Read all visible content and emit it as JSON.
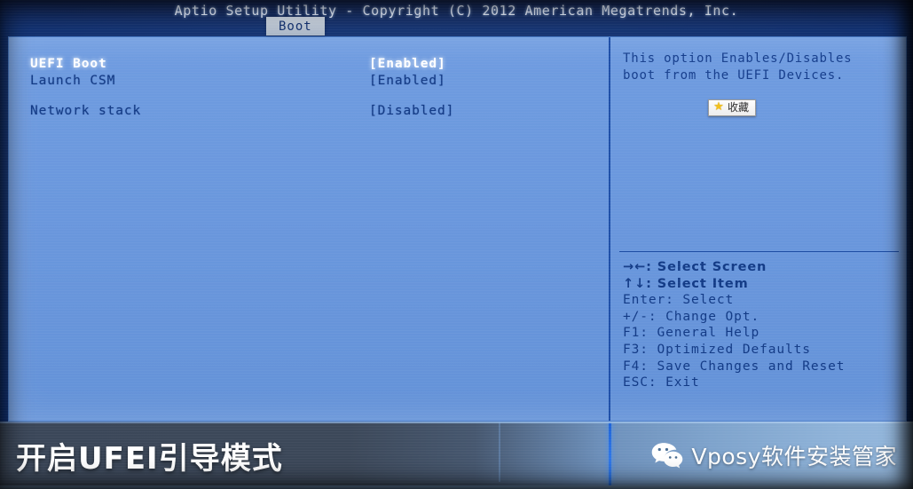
{
  "bios": {
    "title": "Aptio Setup Utility - Copyright (C) 2012 American Megatrends, Inc.",
    "active_tab": "Boot",
    "tabs": [
      "Boot"
    ],
    "options": [
      {
        "label": "UEFI Boot",
        "value": "[Enabled]",
        "selected": true
      },
      {
        "label": "Launch CSM",
        "value": "[Enabled]",
        "selected": false
      },
      {
        "label": "Network stack",
        "value": "[Disabled]",
        "selected": false
      }
    ],
    "help": {
      "line1": "This option Enables/Disables",
      "line2": "boot from the UEFI Devices."
    },
    "key_legend": [
      "→←: Select Screen",
      "↑↓: Select Item",
      "Enter: Select",
      "+/-: Change Opt.",
      "F1: General Help",
      "F3: Optimized Defaults",
      "F4: Save Changes and Reset",
      "ESC: Exit"
    ]
  },
  "overlay": {
    "favorite_button": {
      "label": "收藏",
      "icon": "star-icon",
      "glyph": "★"
    },
    "caption": "开启UFEI引导模式",
    "watermark": {
      "text": "Vposy软件安装管家",
      "icon": "wechat-icon"
    }
  },
  "colors": {
    "header_navy": "#0a2a6b",
    "panel_blue": "#6a97dd",
    "selected_text": "#ffffff",
    "normal_text": "#123a86",
    "divider_blue": "#1e4fa8",
    "tab_bg": "#c9d2de",
    "caption_bar_dark": "#3b4759",
    "star_gold": "#f3c01a"
  }
}
